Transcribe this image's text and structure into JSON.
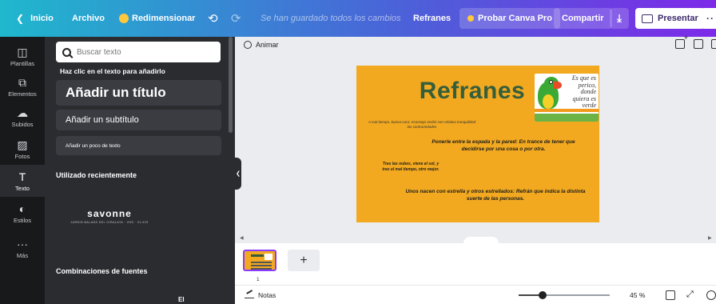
{
  "topbar": {
    "home_label": "Inicio",
    "file_label": "Archivo",
    "resize_label": "Redimensionar",
    "saved_status": "Se han guardado todos los cambios",
    "doc_title": "Refranes",
    "pro_label": "Probar Canva Pro",
    "share_label": "Compartir",
    "present_label": "Presentar",
    "more_label": "··"
  },
  "rail": {
    "items": [
      {
        "label": "Plantillas",
        "icon": "◫"
      },
      {
        "label": "Elementos",
        "icon": "⧉"
      },
      {
        "label": "Subidos",
        "icon": "☁"
      },
      {
        "label": "Fotos",
        "icon": "▨"
      },
      {
        "label": "Texto",
        "icon": "T"
      },
      {
        "label": "Estilos",
        "icon": "◐"
      },
      {
        "label": "Más",
        "icon": "···"
      }
    ]
  },
  "panel": {
    "search_placeholder": "Buscar texto",
    "hint": "Haz clic en el texto para añadirlo",
    "heading_btn": "Añadir un título",
    "subheading_btn": "Añadir un subtítulo",
    "body_btn": "Añadir un poco de texto",
    "recent_title": "Utilizado recientemente",
    "recent_font_name": "savonne",
    "recent_font_tagline": "JARDIN BALANS DEL GIRALATA · VHS · 01.023",
    "combos_title": "Combinaciones de fuentes",
    "combo_preview": "El"
  },
  "canvas": {
    "animate_label": "Animar",
    "slide": {
      "title": "Refranes",
      "parrot_text": "Es que es perico, donde quiera es verde",
      "small_text": "A mal tiempo, buena cara: Aconseja recibir con relativa tranquilidad las contrariedades",
      "line1": "Ponerle entre la espada y la pared: En trance de tener que decidirse por una cosa o por otra.",
      "line2": "Tras las nubes, viene el sol, y tras el mal tiempo, otro mejor.",
      "line3": "Unos nacen con estrella y otros estrellados: Refrán que indica la distinta suerte de las personas."
    }
  },
  "pages": {
    "current_page_number": "1",
    "add_page_label": "+"
  },
  "footer": {
    "notes_label": "Notas",
    "zoom_label": "45 %",
    "zoom_level": 0.26
  },
  "colors": {
    "slide_bg": "#f2a920",
    "title_green": "#355e3b",
    "brand_gradient_start": "#1fb8cd",
    "brand_gradient_end": "#7d2ae8",
    "crown_gold": "#ffc83d"
  }
}
